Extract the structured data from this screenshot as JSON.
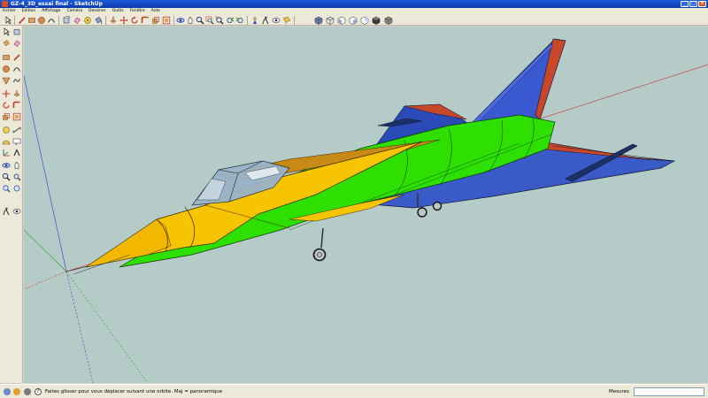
{
  "window": {
    "title": "GZ-4_3D_essai final - SketchUp"
  },
  "menu": [
    "Fichier",
    "Edition",
    "Affichage",
    "Caméra",
    "Dessiner",
    "Outils",
    "Fenêtre",
    "Aide"
  ],
  "toolbar_icons": [
    "select-arrow-icon",
    "line-pencil-icon",
    "rectangle-icon",
    "circle-icon",
    "arc-icon",
    "make-component-icon",
    "eraser-icon",
    "tape-measure-icon",
    "paint-bucket-icon",
    "push-pull-icon",
    "move-icon",
    "rotate-icon",
    "follow-me-icon",
    "scale-icon",
    "offset-icon",
    "orbit-icon",
    "pan-icon",
    "zoom-icon",
    "zoom-window-icon",
    "zoom-extents-icon",
    "previous-view-icon",
    "next-view-icon",
    "position-camera-icon",
    "walk-icon",
    "look-around-icon",
    "section-plane-icon",
    "iso-view-icon",
    "top-view-icon",
    "front-view-icon",
    "right-view-icon",
    "back-view-icon",
    "left-view-icon",
    "xray-icon",
    "wireframe-icon",
    "hidden-line-icon",
    "shaded-icon",
    "shaded-texture-icon",
    "monochrome-icon"
  ],
  "status": {
    "message": "Faites glisser pour vous déplacer suivant une orbite.  Maj = panoramique",
    "measure_label": "Mesures",
    "measure_value": ""
  },
  "colors": {
    "background": "#b5cbc8",
    "yellow": "#f5c400",
    "green": "#21e000",
    "blue": "#3256c8",
    "red": "#cc4a2a"
  }
}
